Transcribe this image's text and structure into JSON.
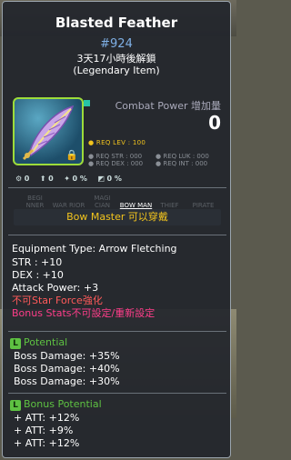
{
  "tooltip": {
    "title": "Blasted Feather",
    "item_id": "#924",
    "unlock_time": "3天17小時後解鎖",
    "grade": "(Legendary Item)",
    "combat_power_label": "Combat Power 增加量",
    "combat_power_value": "0",
    "req_level": "● REQ LEV : 100",
    "req": [
      "● REQ STR : 000",
      "● REQ LUK : 000",
      "● REQ DEX : 000",
      "● REQ INT : 000"
    ],
    "stat_icons": [
      "0",
      "0",
      "0 %",
      "0 %"
    ],
    "jobs": [
      "BEGI NNER",
      "WAR RIOR",
      "MAGI CIAN",
      "BOW MAN",
      "THIEF",
      "PIRATE"
    ],
    "active_job": "BOW MAN",
    "job_notice": "Bow Master 可以穿戴",
    "equipment_type": "Equipment Type: Arrow Fletching",
    "stats": [
      "STR : +10",
      "DEX : +10",
      "Attack Power: +3"
    ],
    "no_star_force": "不可Star Force強化",
    "bonus_stats_note": "Bonus Stats不可設定/重新設定",
    "potential": {
      "badge": "L",
      "label": "Potential",
      "lines": [
        "Boss Damage: +35%",
        "Boss Damage: +40%",
        "Boss Damage: +30%"
      ]
    },
    "bonus_potential": {
      "badge": "L",
      "label": "Bonus Potential",
      "lines": [
        "+ ATT: +12%",
        "+ ATT: +9%",
        "+ ATT: +12%"
      ]
    }
  },
  "colors": {
    "potential_green": "#5ec242",
    "star_blue": "#7fb0e6",
    "req_yellow": "#f2c41d",
    "warning_red": "#ff5a5a"
  }
}
